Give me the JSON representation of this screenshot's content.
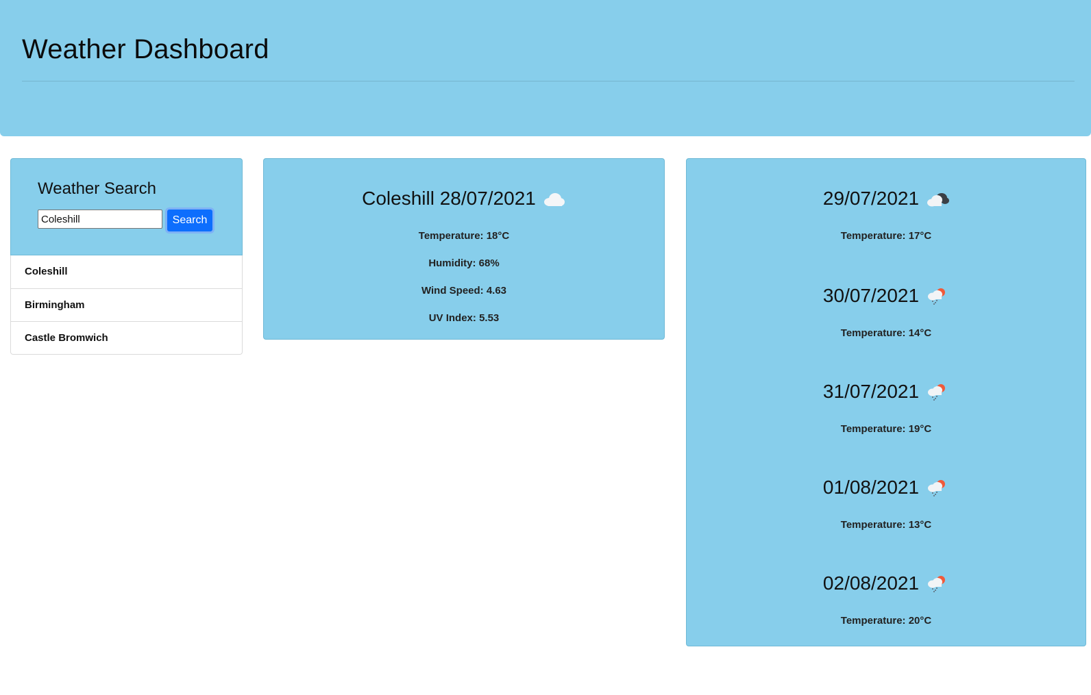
{
  "header": {
    "title": "Weather Dashboard"
  },
  "search": {
    "heading": "Weather Search",
    "input_value": "Coleshill",
    "button_label": "Search"
  },
  "history": [
    "Coleshill",
    "Birmingham",
    "Castle Bromwich"
  ],
  "current": {
    "title": "Coleshill 28/07/2021",
    "icon": "cloud-icon",
    "temperature": "Temperature: 18°C",
    "humidity": "Humidity: 68%",
    "wind": "Wind Speed: 4.63",
    "uv": "UV Index: 5.53"
  },
  "forecast": [
    {
      "date": "29/07/2021",
      "icon": "broken-clouds-icon",
      "temperature": "Temperature: 17°C"
    },
    {
      "date": "30/07/2021",
      "icon": "rain-sun-icon",
      "temperature": "Temperature: 14°C"
    },
    {
      "date": "31/07/2021",
      "icon": "rain-sun-icon",
      "temperature": "Temperature: 19°C"
    },
    {
      "date": "01/08/2021",
      "icon": "rain-sun-icon",
      "temperature": "Temperature: 13°C"
    },
    {
      "date": "02/08/2021",
      "icon": "rain-sun-icon",
      "temperature": "Temperature: 20°C"
    }
  ],
  "colors": {
    "panel": "#87ceeb",
    "button": "#0d6efd"
  }
}
